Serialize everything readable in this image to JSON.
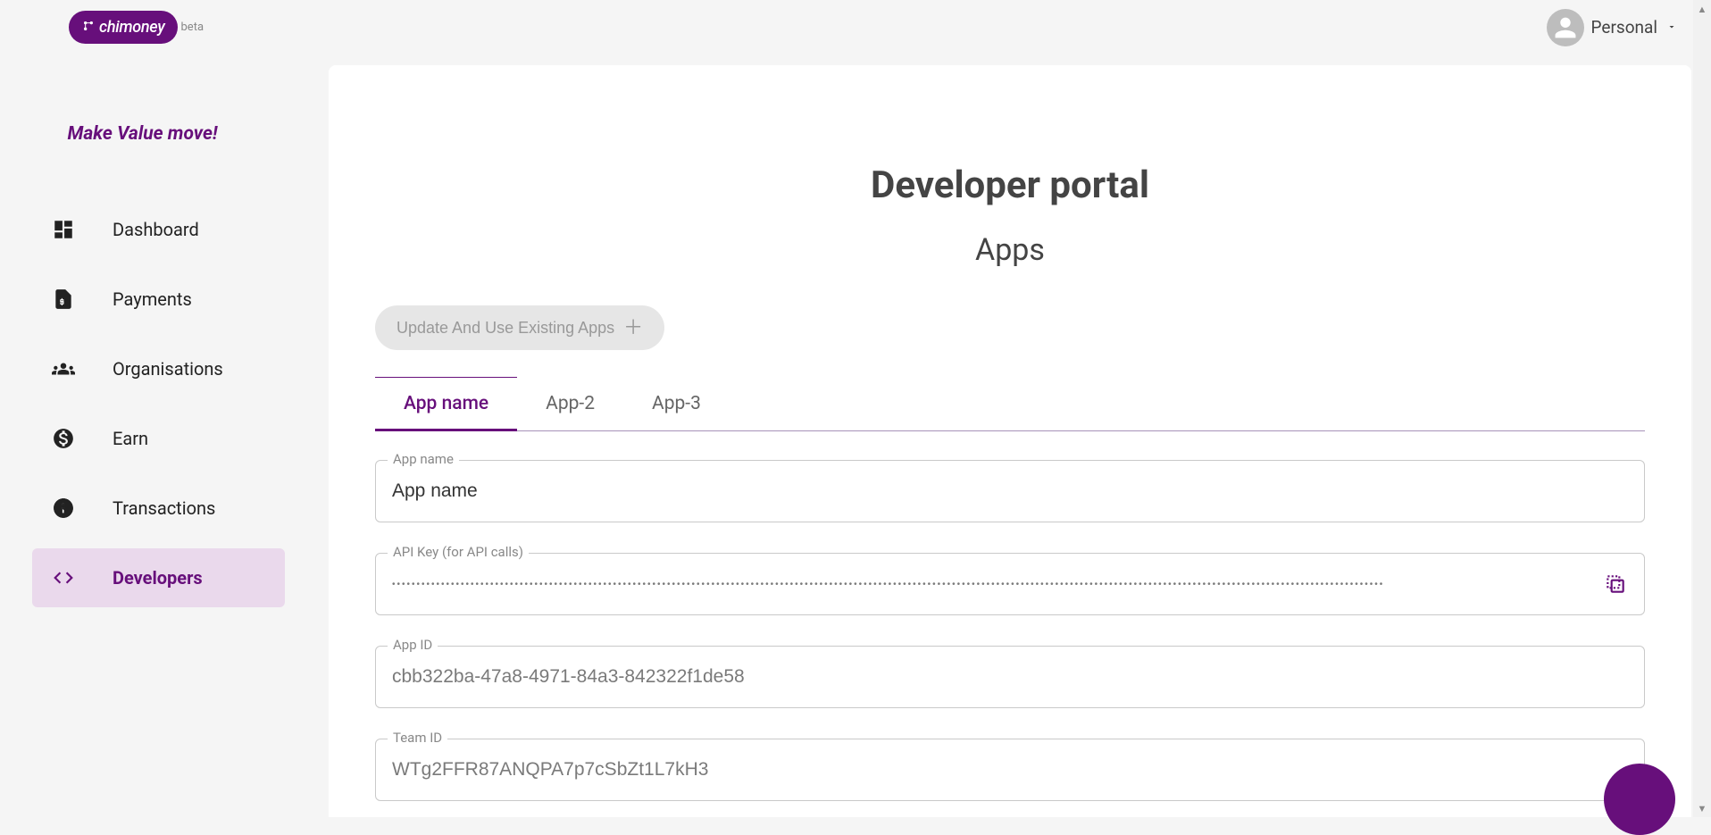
{
  "brand": {
    "name": "chimoney",
    "badge": "beta",
    "tagline": "Make Value move!",
    "color": "#670f7b"
  },
  "account": {
    "name": "Personal"
  },
  "sidebar": {
    "items": [
      {
        "label": "Dashboard",
        "icon": "dashboard-icon"
      },
      {
        "label": "Payments",
        "icon": "payments-icon"
      },
      {
        "label": "Organisations",
        "icon": "organisations-icon"
      },
      {
        "label": "Earn",
        "icon": "earn-icon"
      },
      {
        "label": "Transactions",
        "icon": "transactions-icon"
      },
      {
        "label": "Developers",
        "icon": "developers-icon"
      }
    ],
    "activeIndex": 5
  },
  "main": {
    "title": "Developer portal",
    "subtitle": "Apps",
    "updateButton": "Update And Use Existing Apps",
    "tabs": [
      {
        "label": "App name"
      },
      {
        "label": "App-2"
      },
      {
        "label": "App-3"
      }
    ],
    "activeTabIndex": 0,
    "fields": {
      "appName": {
        "label": "App name",
        "value": "App name"
      },
      "apiKey": {
        "label": "API Key (for API calls)",
        "value": "••••••••••••••••••••••••••••••••••••••••••••••••••••••••••••••••••••••••••••••••••••••••••••••••••••••••••••••••••••••••••••••••••••••••••••••••••••••••••••••••••••••••••••••••••••••••••••••••••••••••••"
      },
      "appId": {
        "label": "App ID",
        "value": "cbb322ba-47a8-4971-84a3-842322f1de58"
      },
      "teamId": {
        "label": "Team ID",
        "value": "WTg2FFR87ANQPA7p7cSbZt1L7kH3"
      }
    }
  }
}
